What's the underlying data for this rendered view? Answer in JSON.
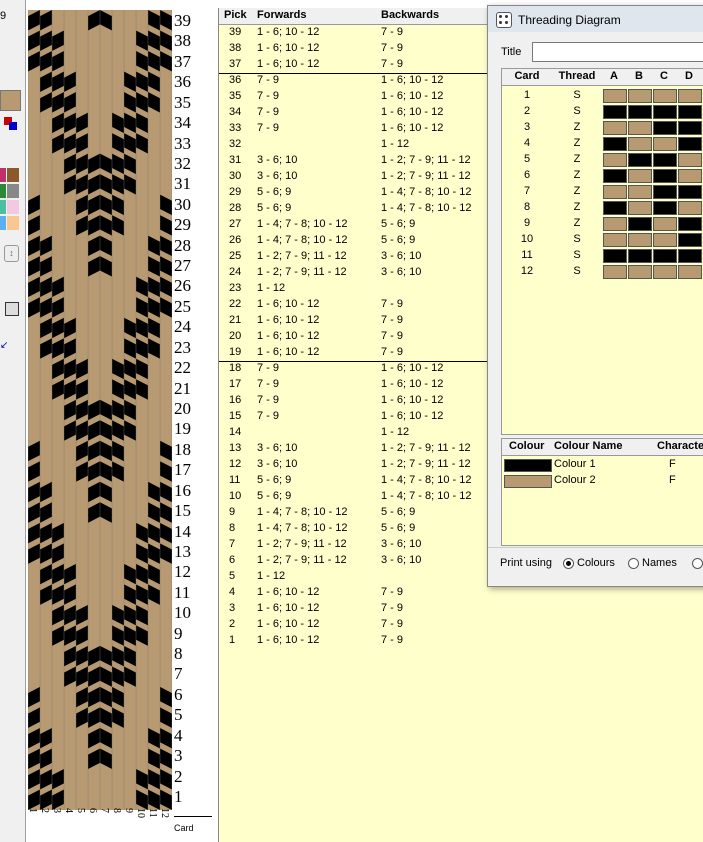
{
  "colors": {
    "dark": "#000000",
    "tan": "#b89a72",
    "grid_bg": "#ffffcc"
  },
  "left_strip": {
    "top_number": "9"
  },
  "weave": {
    "picks": 39,
    "cards": 12
  },
  "pick_numbers": [
    "39",
    "38",
    "37",
    "36",
    "35",
    "34",
    "33",
    "32",
    "31",
    "30",
    "29",
    "28",
    "27",
    "26",
    "25",
    "24",
    "23",
    "22",
    "21",
    "20",
    "19",
    "18",
    "17",
    "16",
    "15",
    "14",
    "13",
    "12",
    "11",
    "10",
    "9",
    "8",
    "7",
    "6",
    "5",
    "4",
    "3",
    "2",
    "1"
  ],
  "card_numbers": [
    "1",
    "2",
    "3",
    "4",
    "5",
    "6",
    "7",
    "8",
    "9",
    "10",
    "11",
    "12"
  ],
  "card_label": "Card",
  "grid": {
    "headers": {
      "pick": "Pick",
      "forwards": "Forwards",
      "backwards": "Backwards"
    },
    "rows": [
      {
        "pick": "39",
        "fwd": "1 - 6; 10 - 12",
        "bwd": "7 - 9"
      },
      {
        "pick": "38",
        "fwd": "1 - 6; 10 - 12",
        "bwd": "7 - 9"
      },
      {
        "pick": "37",
        "fwd": "1 - 6; 10 - 12",
        "bwd": "7 - 9"
      },
      {
        "pick": "36",
        "fwd": "7 - 9",
        "bwd": "1 - 6; 10 - 12"
      },
      {
        "pick": "35",
        "fwd": "7 - 9",
        "bwd": "1 - 6; 10 - 12"
      },
      {
        "pick": "34",
        "fwd": "7 - 9",
        "bwd": "1 - 6; 10 - 12"
      },
      {
        "pick": "33",
        "fwd": "7 - 9",
        "bwd": "1 - 6; 10 - 12"
      },
      {
        "pick": "32",
        "fwd": "",
        "bwd": "1 - 12"
      },
      {
        "pick": "31",
        "fwd": "3 - 6; 10",
        "bwd": "1 - 2; 7 - 9; 11 - 12"
      },
      {
        "pick": "30",
        "fwd": "3 - 6; 10",
        "bwd": "1 - 2; 7 - 9; 11 - 12"
      },
      {
        "pick": "29",
        "fwd": "5 - 6; 9",
        "bwd": "1 - 4; 7 - 8; 10 - 12"
      },
      {
        "pick": "28",
        "fwd": "5 - 6; 9",
        "bwd": "1 - 4; 7 - 8; 10 - 12"
      },
      {
        "pick": "27",
        "fwd": "1 - 4; 7 - 8; 10 - 12",
        "bwd": "5 - 6; 9"
      },
      {
        "pick": "26",
        "fwd": "1 - 4; 7 - 8; 10 - 12",
        "bwd": "5 - 6; 9"
      },
      {
        "pick": "25",
        "fwd": "1 - 2; 7 - 9; 11 - 12",
        "bwd": "3 - 6; 10"
      },
      {
        "pick": "24",
        "fwd": "1 - 2; 7 - 9; 11 - 12",
        "bwd": "3 - 6; 10"
      },
      {
        "pick": "23",
        "fwd": "1 - 12",
        "bwd": ""
      },
      {
        "pick": "22",
        "fwd": "1 - 6; 10 - 12",
        "bwd": "7 - 9"
      },
      {
        "pick": "21",
        "fwd": "1 - 6; 10 - 12",
        "bwd": "7 - 9"
      },
      {
        "pick": "20",
        "fwd": "1 - 6; 10 - 12",
        "bwd": "7 - 9"
      },
      {
        "pick": "19",
        "fwd": "1 - 6; 10 - 12",
        "bwd": "7 - 9"
      },
      {
        "pick": "18",
        "fwd": "7 - 9",
        "bwd": "1 - 6; 10 - 12"
      },
      {
        "pick": "17",
        "fwd": "7 - 9",
        "bwd": "1 - 6; 10 - 12"
      },
      {
        "pick": "16",
        "fwd": "7 - 9",
        "bwd": "1 - 6; 10 - 12"
      },
      {
        "pick": "15",
        "fwd": "7 - 9",
        "bwd": "1 - 6; 10 - 12"
      },
      {
        "pick": "14",
        "fwd": "",
        "bwd": "1 - 12"
      },
      {
        "pick": "13",
        "fwd": "3 - 6; 10",
        "bwd": "1 - 2; 7 - 9; 11 - 12"
      },
      {
        "pick": "12",
        "fwd": "3 - 6; 10",
        "bwd": "1 - 2; 7 - 9; 11 - 12"
      },
      {
        "pick": "11",
        "fwd": "5 - 6; 9",
        "bwd": "1 - 4; 7 - 8; 10 - 12"
      },
      {
        "pick": "10",
        "fwd": "5 - 6; 9",
        "bwd": "1 - 4; 7 - 8; 10 - 12"
      },
      {
        "pick": "9",
        "fwd": "1 - 4; 7 - 8; 10 - 12",
        "bwd": "5 - 6; 9"
      },
      {
        "pick": "8",
        "fwd": "1 - 4; 7 - 8; 10 - 12",
        "bwd": "5 - 6; 9"
      },
      {
        "pick": "7",
        "fwd": "1 - 2; 7 - 9; 11 - 12",
        "bwd": "3 - 6; 10"
      },
      {
        "pick": "6",
        "fwd": "1 - 2; 7 - 9; 11 - 12",
        "bwd": "3 - 6; 10"
      },
      {
        "pick": "5",
        "fwd": "1 - 12",
        "bwd": ""
      },
      {
        "pick": "4",
        "fwd": "1 - 6; 10 - 12",
        "bwd": "7 - 9"
      },
      {
        "pick": "3",
        "fwd": "1 - 6; 10 - 12",
        "bwd": "7 - 9"
      },
      {
        "pick": "2",
        "fwd": "1 - 6; 10 - 12",
        "bwd": "7 - 9"
      },
      {
        "pick": "1",
        "fwd": "1 - 6; 10 - 12",
        "bwd": "7 - 9"
      }
    ]
  },
  "dialog": {
    "title": "Threading Diagram",
    "title_label": "Title",
    "title_value": "",
    "card_headers": [
      "Card",
      "Thread",
      "A",
      "B",
      "C",
      "D"
    ],
    "cards": [
      {
        "card": "1",
        "thread": "S",
        "holes": [
          "tan",
          "tan",
          "tan",
          "tan"
        ]
      },
      {
        "card": "2",
        "thread": "S",
        "holes": [
          "dark",
          "dark",
          "dark",
          "dark"
        ]
      },
      {
        "card": "3",
        "thread": "Z",
        "holes": [
          "tan",
          "tan",
          "dark",
          "dark"
        ]
      },
      {
        "card": "4",
        "thread": "Z",
        "holes": [
          "dark",
          "tan",
          "tan",
          "dark"
        ]
      },
      {
        "card": "5",
        "thread": "Z",
        "holes": [
          "tan",
          "dark",
          "dark",
          "tan"
        ]
      },
      {
        "card": "6",
        "thread": "Z",
        "holes": [
          "dark",
          "tan",
          "dark",
          "tan"
        ]
      },
      {
        "card": "7",
        "thread": "Z",
        "holes": [
          "tan",
          "tan",
          "dark",
          "dark"
        ]
      },
      {
        "card": "8",
        "thread": "Z",
        "holes": [
          "dark",
          "tan",
          "dark",
          "tan"
        ]
      },
      {
        "card": "9",
        "thread": "Z",
        "holes": [
          "tan",
          "dark",
          "tan",
          "dark"
        ]
      },
      {
        "card": "10",
        "thread": "S",
        "holes": [
          "tan",
          "tan",
          "tan",
          "dark"
        ]
      },
      {
        "card": "11",
        "thread": "S",
        "holes": [
          "dark",
          "dark",
          "dark",
          "dark"
        ]
      },
      {
        "card": "12",
        "thread": "S",
        "holes": [
          "tan",
          "tan",
          "tan",
          "tan"
        ]
      }
    ],
    "colour_headers": [
      "Colour",
      "Colour Name",
      "Characte"
    ],
    "colours": [
      {
        "swatch": "dark",
        "name": "Colour 1",
        "char": "F"
      },
      {
        "swatch": "tan",
        "name": "Colour 2",
        "char": "F"
      }
    ],
    "print_label": "Print using",
    "print_options": [
      {
        "label": "Colours",
        "checked": true
      },
      {
        "label": "Names",
        "checked": false
      },
      {
        "label": "",
        "checked": false
      }
    ]
  }
}
